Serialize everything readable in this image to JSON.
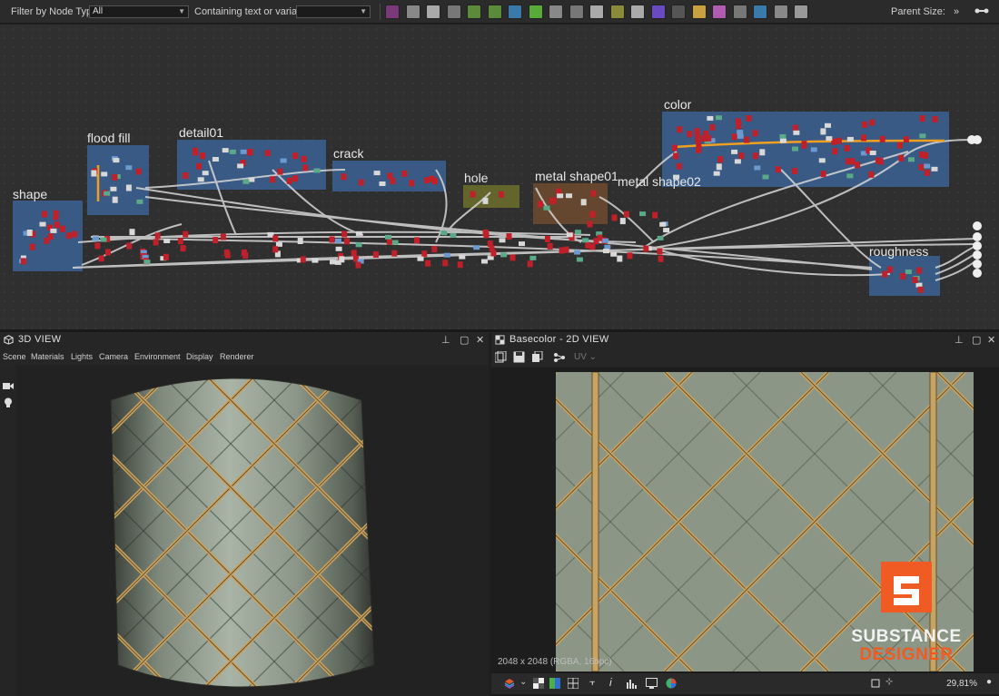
{
  "toolbar": {
    "filter_label": "Filter by Node Type",
    "filter_value": "All",
    "containing_label": "Containing text or variable",
    "containing_value": "",
    "parent_size_label": "Parent Size:",
    "more": "»",
    "icons": [
      "output-node-icon",
      "uniform-color-icon",
      "grayscale-icon",
      "blend-icon",
      "gradient-icon",
      "transform-icon",
      "warp-icon",
      "levels-icon",
      "curve-icon",
      "sharpen-icon",
      "blur-icon",
      "hsl-icon",
      "histogram-icon",
      "normal-icon",
      "text-icon",
      "fx-map-icon",
      "pixel-processor-icon",
      "comment-icon",
      "frame-icon",
      "pin-icon",
      "link-icon"
    ]
  },
  "graph": {
    "frames": [
      {
        "id": "shape",
        "title": "shape"
      },
      {
        "id": "flood-fill",
        "title": "flood fill"
      },
      {
        "id": "detail01",
        "title": "detail01"
      },
      {
        "id": "crack",
        "title": "crack"
      },
      {
        "id": "hole",
        "title": "hole"
      },
      {
        "id": "metal-shape01",
        "title": "metal shape01"
      },
      {
        "id": "metal-shape02",
        "title": "metal shape02"
      },
      {
        "id": "color",
        "title": "color"
      },
      {
        "id": "roughness",
        "title": "roughness"
      }
    ]
  },
  "view3d": {
    "title": "3D VIEW",
    "menu": [
      "Scene",
      "Materials",
      "Lights",
      "Camera",
      "Environment",
      "Display",
      "Renderer"
    ]
  },
  "view2d": {
    "title": "Basecolor - 2D VIEW",
    "uv_label": "UV",
    "resolution": "2048 x 2048 (RGBA, 16bpc)",
    "zoom": "29,81%"
  },
  "logo": {
    "line1": "SUBSTANCE",
    "line2": "DESIGNER"
  },
  "colors": {
    "frame_blue": "#3a5f8f",
    "frame_olive": "#6a6a2e",
    "frame_brown": "#6b4a30",
    "node_red": "#c0202a",
    "wire": "#d7d7d7",
    "wire_orange": "#f0a020",
    "accent": "#f05a23",
    "stone": "#8e9a8a",
    "gold": "#c8a463"
  }
}
